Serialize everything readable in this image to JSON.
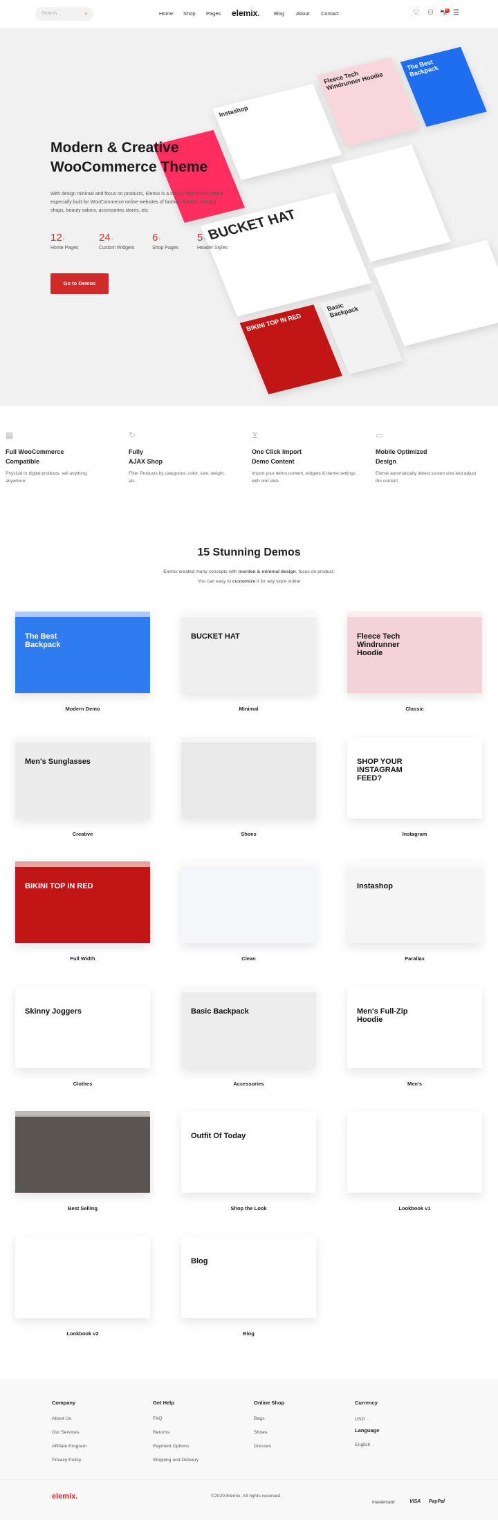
{
  "header": {
    "search_placeholder": "Search...",
    "nav": [
      "Home",
      "Shop",
      "Pages",
      "Blog",
      "About",
      "Contact"
    ],
    "logo": "elemix",
    "cart_count": "0"
  },
  "hero": {
    "title_line1": "Modern & Creative",
    "title_line2": "WooCommerce Theme",
    "description": "With design minimal and focus on products, Elemix is a classy WordPress theme especially built for WooCommerce online websites of fashion brands, clothing shops, beauty salons, accessories stores, etc.",
    "stats": [
      {
        "value": "12",
        "label": "Home Pages"
      },
      {
        "value": "24",
        "label": "Custom Widgets"
      },
      {
        "value": "6",
        "label": "Shop Pages"
      },
      {
        "value": "5",
        "label": "Header Styles"
      }
    ],
    "plus": "+",
    "cta": "Go to Demos",
    "collage_texts": [
      "BUCKET HAT",
      "Instashop",
      "Fleece Tech Windrunner Hoodie",
      "The Best Backpack",
      "BIKINI TOP IN RED",
      "Basic Backpack"
    ]
  },
  "features": [
    {
      "icon": "store-icon",
      "title1": "Full WooCommerce",
      "title2": "Compatible",
      "desc": "Physical or digital products, sell anything, anywhere."
    },
    {
      "icon": "refresh-icon",
      "title1": "Fully",
      "title2": "AJAX Shop",
      "desc": "Filter Products by categories, color, size, weight, etc."
    },
    {
      "icon": "download-icon",
      "title1": "One Click Import",
      "title2": "Demo Content",
      "desc": "Import your demo content, widgets & theme settings with one click."
    },
    {
      "icon": "monitor-icon",
      "title1": "Mobile Optimized",
      "title2": "Design",
      "desc": "Elemix automatically detect screen size and adjust the content."
    }
  ],
  "demos_section": {
    "title": "15 Stunning Demos",
    "sub1_pre": "Elemix created many concepts with ",
    "sub1_bold": "morden & minimal design",
    "sub1_post": ", focus on product.",
    "sub2_pre": "You can easy to ",
    "sub2_bold": "customize",
    "sub2_post": " it for any store online"
  },
  "demos": [
    {
      "label": "Modern Demo",
      "headline": "The Best Backpack",
      "color": "#2f7cf0"
    },
    {
      "label": "Minimal",
      "headline": "BUCKET HAT",
      "color": "#efefef"
    },
    {
      "label": "Classic",
      "headline": "Fleece Tech Windrunner Hoodie",
      "color": "#f3d3d8"
    },
    {
      "label": "Creative",
      "headline": "Men's Sunglasses",
      "color": "#ececec"
    },
    {
      "label": "Shoes",
      "headline": "",
      "color": "#e9e9e9"
    },
    {
      "label": "Instagram",
      "headline": "SHOP YOUR INSTAGRAM FEED?",
      "color": "#ffffff"
    },
    {
      "label": "Full Width",
      "headline": "BIKINI TOP IN RED",
      "color": "#c21515"
    },
    {
      "label": "Clean",
      "headline": "",
      "color": "#f4f6fa"
    },
    {
      "label": "Parallax",
      "headline": "Instashop",
      "color": "#f5f5f5"
    },
    {
      "label": "Clothes",
      "headline": "Skinny Joggers",
      "color": "#ffffff"
    },
    {
      "label": "Accessories",
      "headline": "Basic Backpack",
      "color": "#ededed"
    },
    {
      "label": "Men's",
      "headline": "Men's Full-Zip Hoodie",
      "color": "#ffffff"
    },
    {
      "label": "Best Selling",
      "headline": "",
      "color": "#5a5550"
    },
    {
      "label": "Shop the Look",
      "headline": "Outfit Of Today",
      "color": "#ffffff"
    },
    {
      "label": "Lookbook v1",
      "headline": "",
      "color": "#ffffff"
    },
    {
      "label": "Lookbook v2",
      "headline": "",
      "color": "#ffffff"
    },
    {
      "label": "Blog",
      "headline": "Blog",
      "color": "#ffffff"
    }
  ],
  "footer": {
    "columns": [
      {
        "title": "Company",
        "links": [
          "About Us",
          "Our Services",
          "Affiliate Program",
          "Privacy Policy"
        ]
      },
      {
        "title": "Get Help",
        "links": [
          "FAQ",
          "Returns",
          "Payment Options",
          "Shipping and Delivery"
        ]
      },
      {
        "title": "Online Shop",
        "links": [
          "Bags",
          "Shoes",
          "Dresses"
        ]
      }
    ],
    "currency_title": "Currency",
    "currency": "USD",
    "language_title": "Language",
    "language": "English",
    "logo": "elemix",
    "copyright": "©2020 Elemix. All rights reserved",
    "payments": [
      "mastercard",
      "VISA",
      "PayPal"
    ]
  },
  "colors": {
    "accent": "#d62b2b",
    "hero_bg": "#f1f1f1",
    "footer_bg": "#f8f8f8"
  }
}
